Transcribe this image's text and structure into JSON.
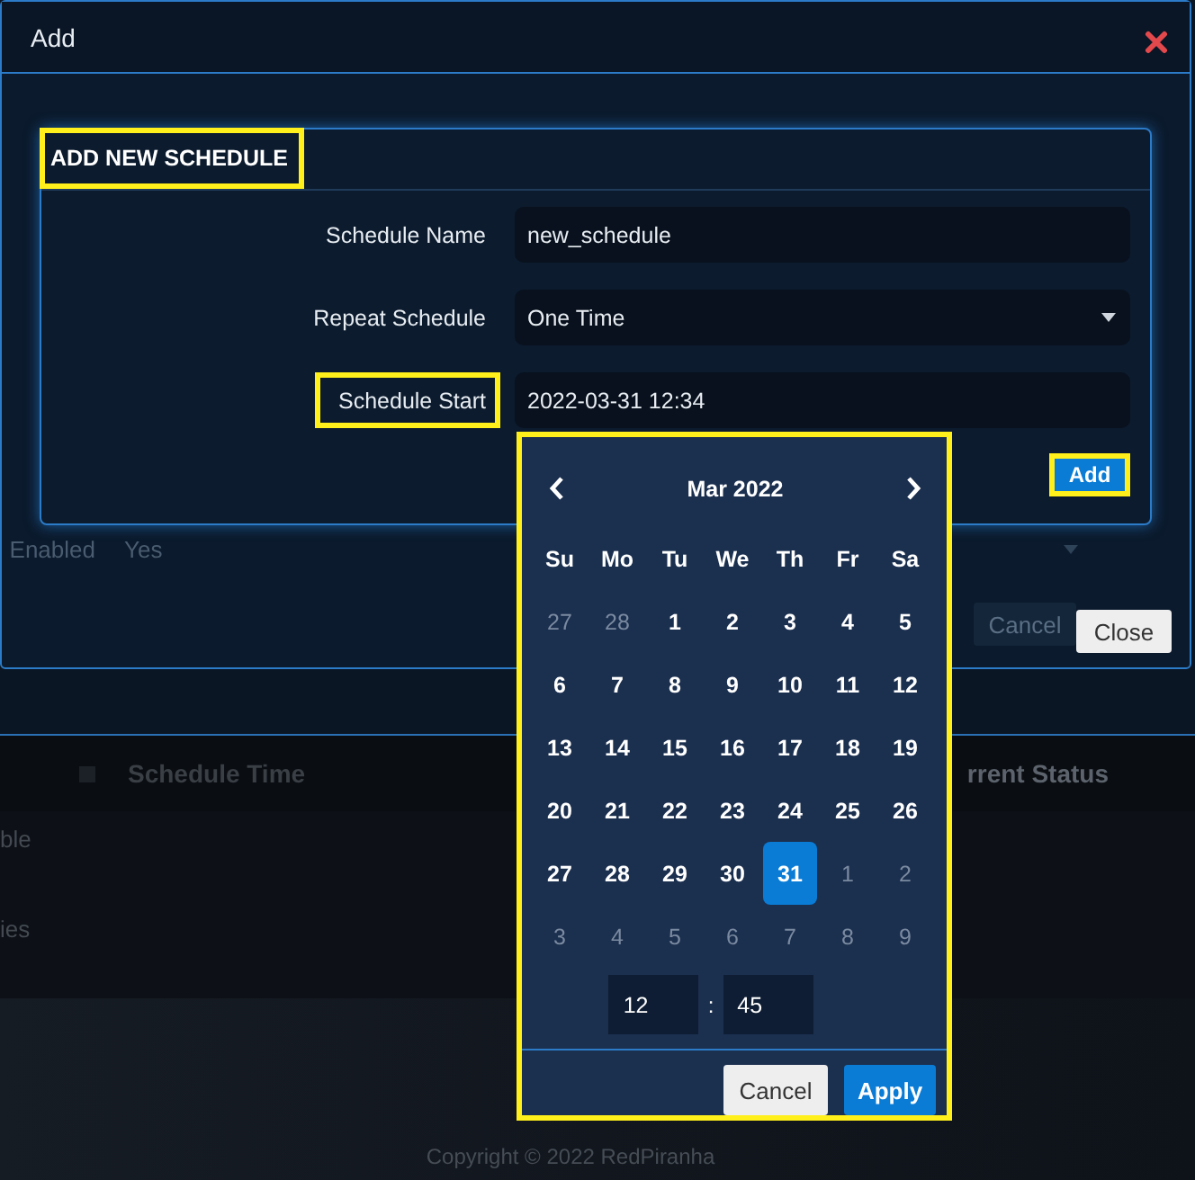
{
  "dialog": {
    "title": "Add"
  },
  "background_form": [
    {
      "label": "Enabled",
      "value": "Yes",
      "kind": "select"
    }
  ],
  "background_buttons": [
    {
      "label": "Cancel",
      "kind": "faded"
    },
    {
      "label": "Close",
      "kind": "default"
    }
  ],
  "schedule_dialog": {
    "heading": "ADD NEW SCHEDULE",
    "heading_highlighted": true,
    "fields": [
      {
        "label": "Schedule Name",
        "value": "new_schedule",
        "kind": "text",
        "highlighted": false
      },
      {
        "label": "Repeat Schedule",
        "value": "One Time",
        "kind": "select",
        "highlighted": false
      },
      {
        "label": "Schedule Start",
        "value": "2022-03-31 12:34",
        "kind": "text",
        "highlighted": true
      }
    ],
    "add_button": {
      "label": "Add",
      "highlighted": true
    }
  },
  "date_picker": {
    "highlighted": true,
    "month": "Mar 2022",
    "weekdays": [
      "Su",
      "Mo",
      "Tu",
      "We",
      "Th",
      "Fr",
      "Sa"
    ],
    "weeks": [
      [
        {
          "day": "27",
          "muted": true,
          "selected": false
        },
        {
          "day": "28",
          "muted": true,
          "selected": false
        },
        {
          "day": "1",
          "muted": false,
          "selected": false
        },
        {
          "day": "2",
          "muted": false,
          "selected": false
        },
        {
          "day": "3",
          "muted": false,
          "selected": false
        },
        {
          "day": "4",
          "muted": false,
          "selected": false
        },
        {
          "day": "5",
          "muted": false,
          "selected": false
        }
      ],
      [
        {
          "day": "6",
          "muted": false,
          "selected": false
        },
        {
          "day": "7",
          "muted": false,
          "selected": false
        },
        {
          "day": "8",
          "muted": false,
          "selected": false
        },
        {
          "day": "9",
          "muted": false,
          "selected": false
        },
        {
          "day": "10",
          "muted": false,
          "selected": false
        },
        {
          "day": "11",
          "muted": false,
          "selected": false
        },
        {
          "day": "12",
          "muted": false,
          "selected": false
        }
      ],
      [
        {
          "day": "13",
          "muted": false,
          "selected": false
        },
        {
          "day": "14",
          "muted": false,
          "selected": false
        },
        {
          "day": "15",
          "muted": false,
          "selected": false
        },
        {
          "day": "16",
          "muted": false,
          "selected": false
        },
        {
          "day": "17",
          "muted": false,
          "selected": false
        },
        {
          "day": "18",
          "muted": false,
          "selected": false
        },
        {
          "day": "19",
          "muted": false,
          "selected": false
        }
      ],
      [
        {
          "day": "20",
          "muted": false,
          "selected": false
        },
        {
          "day": "21",
          "muted": false,
          "selected": false
        },
        {
          "day": "22",
          "muted": false,
          "selected": false
        },
        {
          "day": "23",
          "muted": false,
          "selected": false
        },
        {
          "day": "24",
          "muted": false,
          "selected": false
        },
        {
          "day": "25",
          "muted": false,
          "selected": false
        },
        {
          "day": "26",
          "muted": false,
          "selected": false
        }
      ],
      [
        {
          "day": "27",
          "muted": false,
          "selected": false
        },
        {
          "day": "28",
          "muted": false,
          "selected": false
        },
        {
          "day": "29",
          "muted": false,
          "selected": false
        },
        {
          "day": "30",
          "muted": false,
          "selected": false
        },
        {
          "day": "31",
          "muted": false,
          "selected": true
        },
        {
          "day": "1",
          "muted": true,
          "selected": false
        },
        {
          "day": "2",
          "muted": true,
          "selected": false
        }
      ],
      [
        {
          "day": "3",
          "muted": true,
          "selected": false
        },
        {
          "day": "4",
          "muted": true,
          "selected": false
        },
        {
          "day": "5",
          "muted": true,
          "selected": false
        },
        {
          "day": "6",
          "muted": true,
          "selected": false
        },
        {
          "day": "7",
          "muted": true,
          "selected": false
        },
        {
          "day": "8",
          "muted": true,
          "selected": false
        },
        {
          "day": "9",
          "muted": true,
          "selected": false
        }
      ]
    ],
    "hour": "12",
    "separator": ":",
    "minute": "45",
    "buttons": [
      {
        "label": "Cancel",
        "kind": "secondary"
      },
      {
        "label": "Apply",
        "kind": "primary"
      }
    ]
  },
  "table": {
    "columns": [
      "Schedule Time",
      "rrent Status"
    ],
    "rows": [
      [
        "ble"
      ],
      [
        "ies"
      ]
    ]
  },
  "footer": "Copyright © 2022 RedPiranha"
}
